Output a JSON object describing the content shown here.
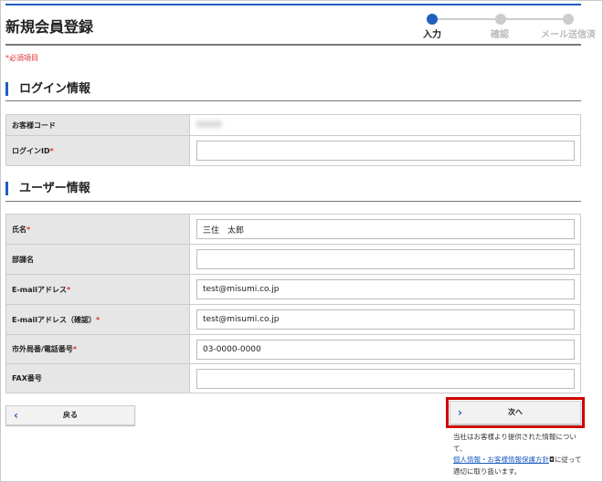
{
  "header": {
    "title": "新規会員登録"
  },
  "steps": [
    {
      "label": "入力",
      "active": true
    },
    {
      "label": "確認",
      "active": false
    },
    {
      "label": "メール送信済",
      "active": false
    }
  ],
  "required_note": "*必須項目",
  "login_section": {
    "title": "ログイン情報",
    "rows": [
      {
        "label": "お客様コード",
        "required": false,
        "value": ""
      },
      {
        "label": "ログインID",
        "required": true,
        "value": ""
      }
    ]
  },
  "user_section": {
    "title": "ユーザー情報",
    "rows": [
      {
        "label": "氏名",
        "required": true,
        "value": "三住　太郎"
      },
      {
        "label": "部課名",
        "required": false,
        "value": ""
      },
      {
        "label": "E-mailアドレス",
        "required": true,
        "value": "test@misumi.co.jp"
      },
      {
        "label": "E-mailアドレス（確認）",
        "required": true,
        "value": "test@misumi.co.jp"
      },
      {
        "label": "市外局番/電話番号",
        "required": true,
        "value": "03-0000-0000"
      },
      {
        "label": "FAX番号",
        "required": false,
        "value": ""
      }
    ]
  },
  "asterisk": "*",
  "buttons": {
    "back": "戻る",
    "next": "次へ"
  },
  "footnote": {
    "before": "当社はお客様より提供された情報について、",
    "link": "個人情報・お客様情報保護方針",
    "after": "に従って適切に取り扱います。"
  },
  "colors": {
    "accent": "#1f5fbf",
    "required": "#e03030",
    "highlight": "#d00000"
  }
}
